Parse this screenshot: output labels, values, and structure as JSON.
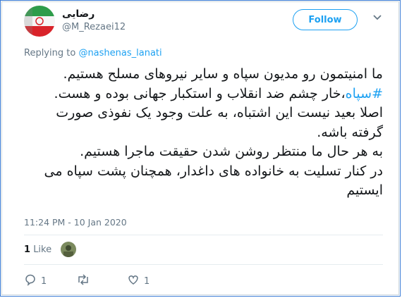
{
  "user": {
    "name": "رضایی",
    "handle": "@M_Rezaei12",
    "follow_label": "Follow"
  },
  "reply": {
    "prefix": "Replying to",
    "target": "@nashenas_lanati"
  },
  "tweet": {
    "line1": "ما امنیتمون رو مدیون سپاه و سایر نیروهای مسلح هستیم.",
    "hashtag": "#سپاه",
    "line2_rest": "،خار چشم ضد انقلاب و استکبار جهانی بوده و هست.",
    "line3": "اصلا بعید نیست این اشتباه، به علت وجود یک نفوذی صورت گرفته باشه.",
    "line4": "به هر حال ما منتظر روشن شدن حقیقت ماجرا هستیم.",
    "line5": "در کنار تسلیت به خانواده های داغدار، همچنان پشت سپاه می ایستیم"
  },
  "timestamp": "11:24 PM - 10 Jan 2020",
  "likes": {
    "count": "1",
    "label": "Like"
  },
  "actions": {
    "reply_count": "1",
    "like_count": "1"
  },
  "icons": {
    "chevron": "chevron-down-icon",
    "reply": "comment-icon",
    "retweet": "retweet-icon",
    "like": "heart-icon"
  },
  "colors": {
    "accent": "#1da1f2",
    "text": "#14171a",
    "muted": "#657786"
  }
}
